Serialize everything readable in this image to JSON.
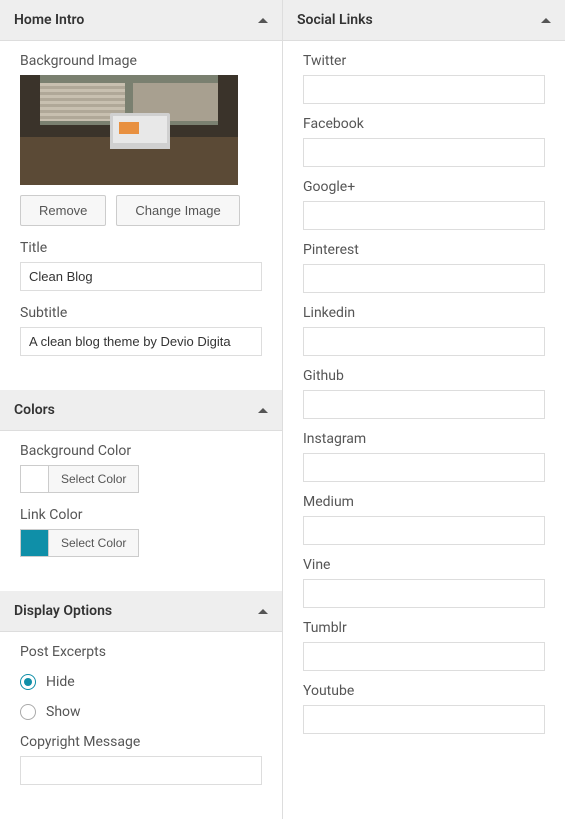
{
  "homeIntro": {
    "headerTitle": "Home Intro",
    "bgImageLabel": "Background Image",
    "removeBtn": "Remove",
    "changeBtn": "Change Image",
    "titleLabel": "Title",
    "titleValue": "Clean Blog",
    "subtitleLabel": "Subtitle",
    "subtitleValue": "A clean blog theme by Devio Digita"
  },
  "colors": {
    "headerTitle": "Colors",
    "bgColorLabel": "Background Color",
    "linkColorLabel": "Link Color",
    "selectBtn": "Select Color",
    "bgColorValue": "#ffffff",
    "linkColorValue": "#0f8fa8"
  },
  "display": {
    "headerTitle": "Display Options",
    "excerptsLabel": "Post Excerpts",
    "hideLabel": "Hide",
    "showLabel": "Show",
    "copyrightLabel": "Copyright Message",
    "copyrightValue": ""
  },
  "social": {
    "headerTitle": "Social Links",
    "fields": {
      "twitter": {
        "label": "Twitter",
        "value": ""
      },
      "facebook": {
        "label": "Facebook",
        "value": ""
      },
      "google": {
        "label": "Google+",
        "value": ""
      },
      "pinterest": {
        "label": "Pinterest",
        "value": ""
      },
      "linkedin": {
        "label": "Linkedin",
        "value": ""
      },
      "github": {
        "label": "Github",
        "value": ""
      },
      "instagram": {
        "label": "Instagram",
        "value": ""
      },
      "medium": {
        "label": "Medium",
        "value": ""
      },
      "vine": {
        "label": "Vine",
        "value": ""
      },
      "tumblr": {
        "label": "Tumblr",
        "value": ""
      },
      "youtube": {
        "label": "Youtube",
        "value": ""
      }
    }
  }
}
